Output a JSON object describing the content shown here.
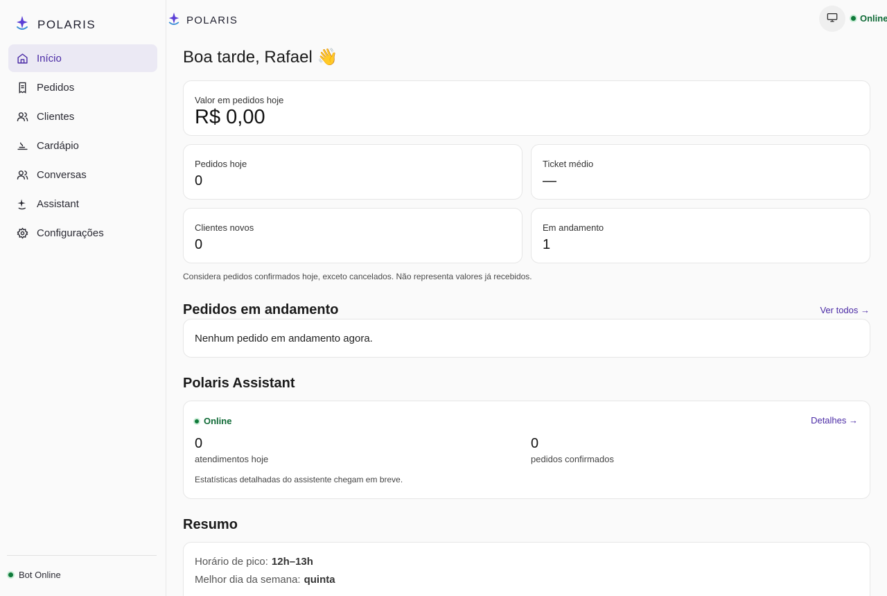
{
  "brand": {
    "name": "POLARIS",
    "accent": "#4a2aa5",
    "star_color": "#5b3fd6"
  },
  "sidebar": {
    "items": [
      {
        "label": "Início",
        "icon": "home-icon",
        "active": true
      },
      {
        "label": "Pedidos",
        "icon": "receipt-icon",
        "active": false
      },
      {
        "label": "Clientes",
        "icon": "users-icon",
        "active": false
      },
      {
        "label": "Cardápio",
        "icon": "menu-book-icon",
        "active": false
      },
      {
        "label": "Conversas",
        "icon": "users-icon",
        "active": false
      },
      {
        "label": "Assistant",
        "icon": "sparkle-icon",
        "active": false
      },
      {
        "label": "Configurações",
        "icon": "gear-icon",
        "active": false
      }
    ],
    "footer_status": "Bot Online"
  },
  "topbar": {
    "brand": "POLARIS",
    "status": "Online",
    "monitor_icon": "monitor-icon"
  },
  "main": {
    "greeting": "Boa tarde, Rafael 👋",
    "revenue": {
      "label": "Valor em pedidos hoje",
      "value": "R$ 0,00"
    },
    "stats": [
      {
        "label": "Pedidos hoje",
        "value": "0"
      },
      {
        "label": "Ticket médio",
        "value": "—"
      },
      {
        "label": "Clientes novos",
        "value": "0"
      },
      {
        "label": "Em andamento",
        "value": "1"
      }
    ],
    "note": "Considera pedidos confirmados hoje, exceto cancelados. Não representa valores já recebidos.",
    "orders_section": {
      "title": "Pedidos em andamento",
      "link": "Ver todos →",
      "empty": "Nenhum pedido em andamento agora."
    },
    "assistant_section": {
      "title": "Polaris Assistant",
      "status": "Online",
      "link": "Detalhes →",
      "metrics": [
        {
          "value": "0",
          "label": "atendimentos hoje"
        },
        {
          "value": "0",
          "label": "pedidos confirmados"
        }
      ],
      "footnote": "Estatísticas detalhadas do assistente chegam em breve."
    },
    "summary_section": {
      "title": "Resumo",
      "rows": [
        {
          "label": "Horário de pico:",
          "value": "12h–13h"
        },
        {
          "label": "Melhor dia da semana:",
          "value": "quinta"
        }
      ]
    }
  },
  "colors": {
    "online_green": "#0f7a3a",
    "active_bg": "#ebe9f4"
  }
}
